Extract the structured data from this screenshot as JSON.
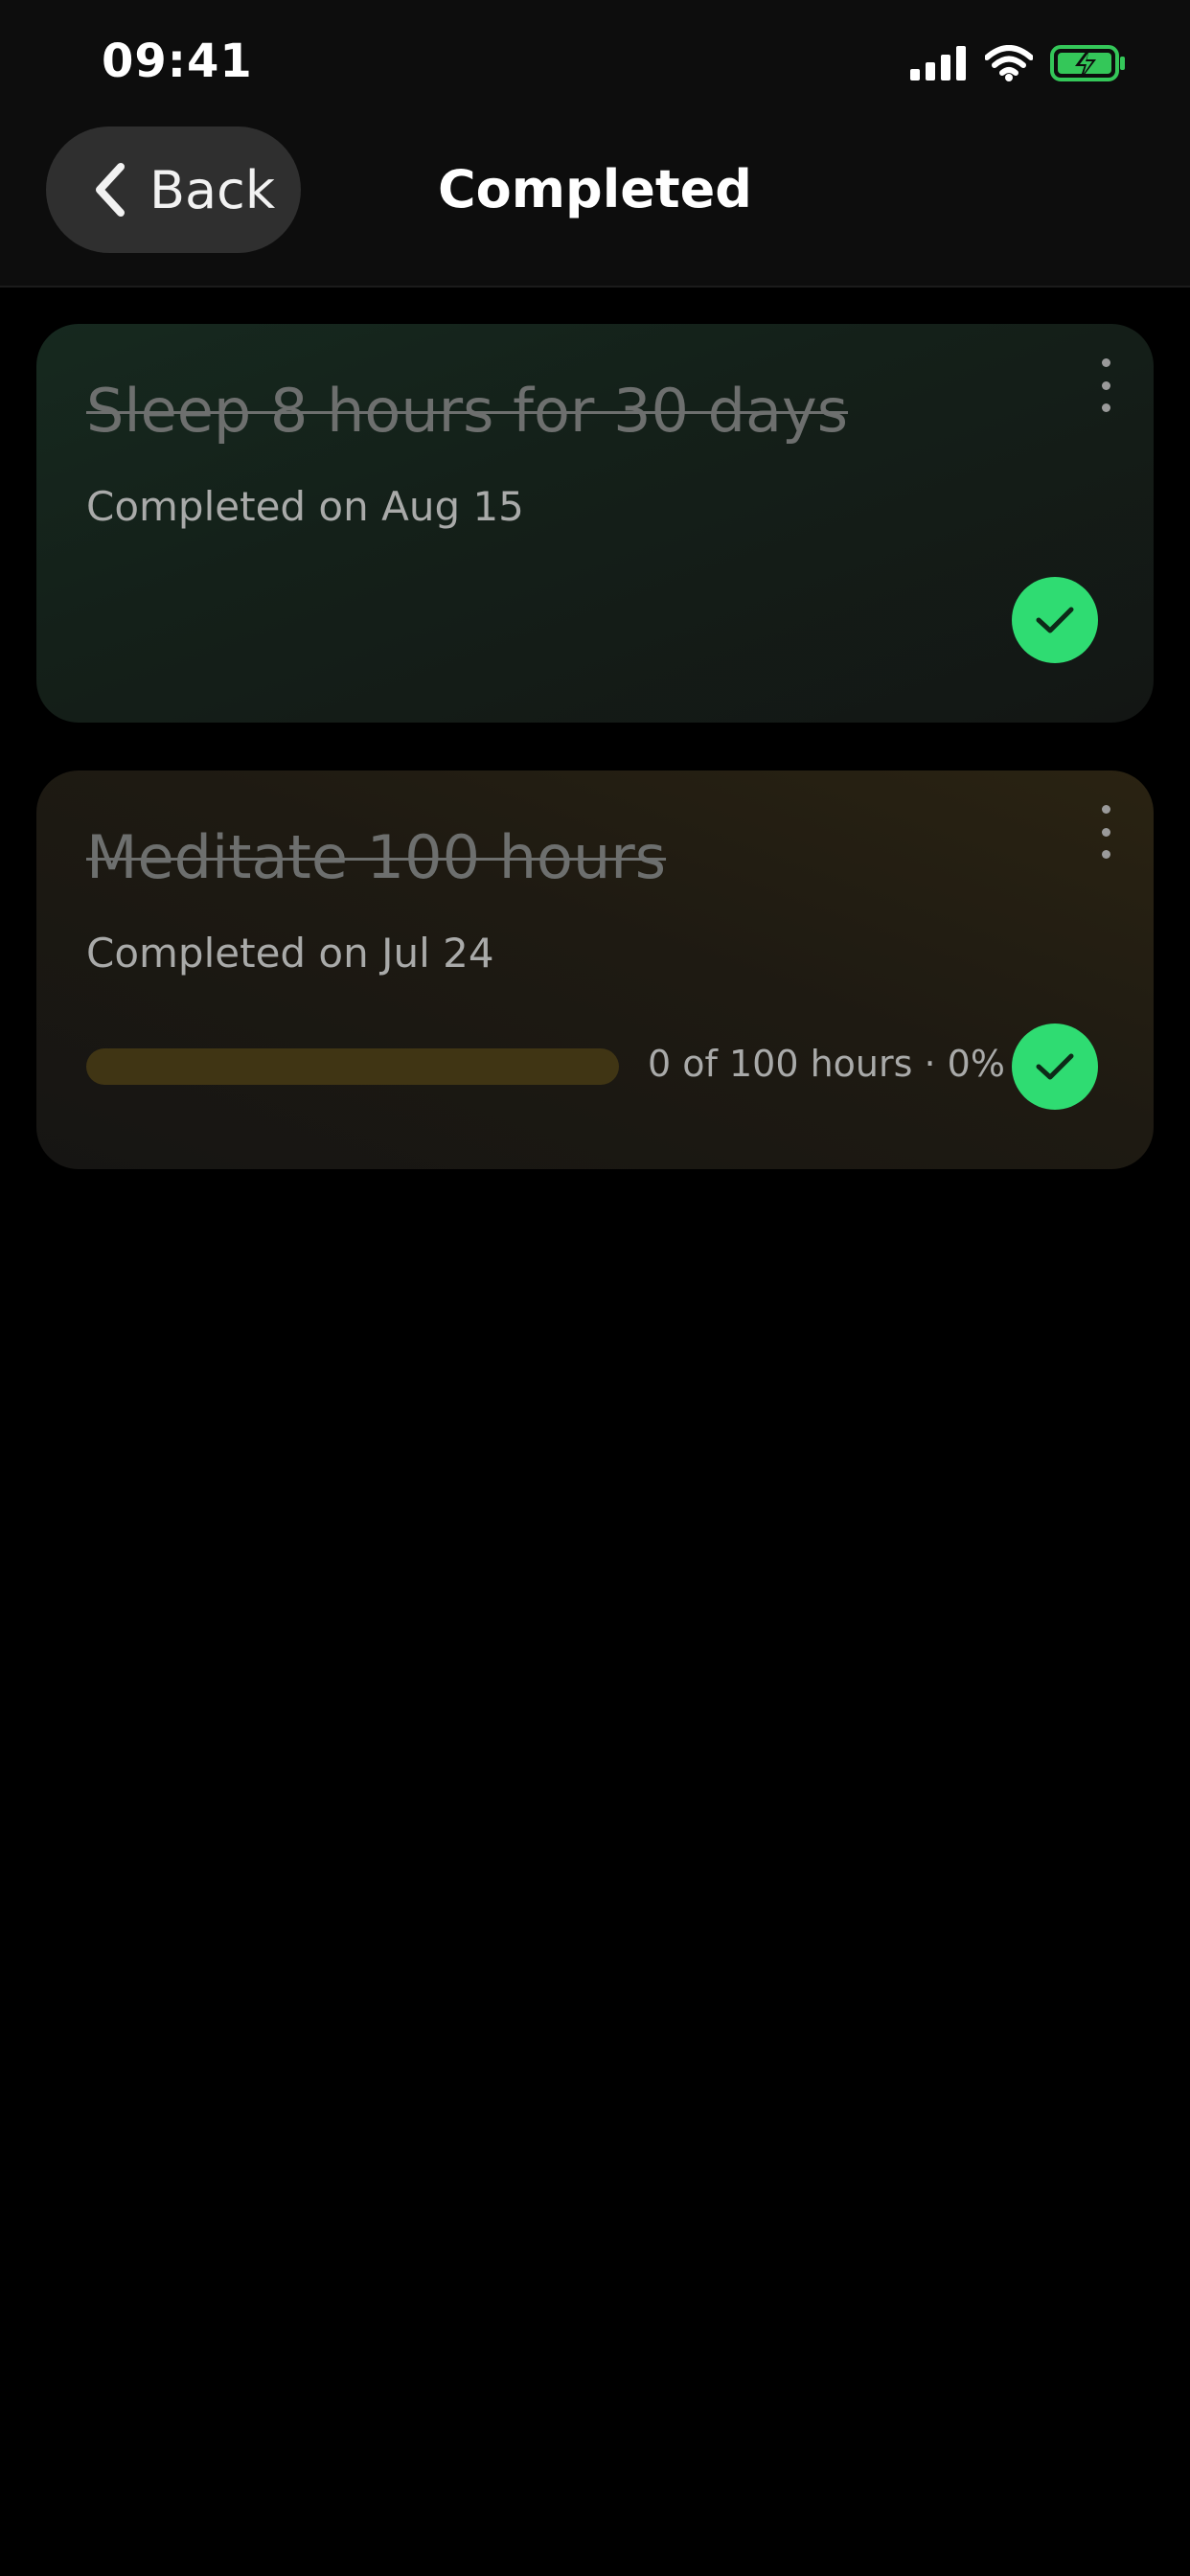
{
  "status_bar": {
    "time": "09:41",
    "signal_icon": "cellular-signal-icon",
    "wifi_icon": "wifi-icon",
    "battery_icon": "battery-charging-icon"
  },
  "nav": {
    "back_label": "Back",
    "back_icon": "chevron-left-icon",
    "title": "Completed"
  },
  "goals": [
    {
      "title": "Sleep 8 hours for 30 days",
      "completed_text": "Completed on Aug 15",
      "menu_icon": "more-vertical-icon",
      "status_icon": "checkmark-icon"
    },
    {
      "title": "Meditate 100 hours",
      "completed_text": "Completed on Jul 24",
      "progress_text": "0 of 100 hours · 0%",
      "progress_fraction": 0,
      "menu_icon": "more-vertical-icon",
      "status_icon": "checkmark-icon"
    }
  ],
  "colors": {
    "accent_green": "#2fdc72",
    "progress_track": "#403514",
    "progress_fill": "#d8a826",
    "battery_green": "#34c759"
  }
}
